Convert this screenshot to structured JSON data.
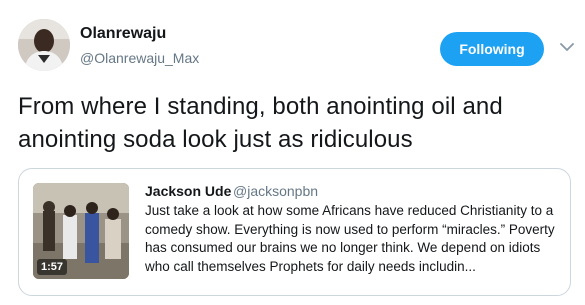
{
  "author": {
    "name": "Olanrewaju",
    "handle": "@Olanrewaju_Max"
  },
  "follow_button": {
    "label": "Following"
  },
  "tweet": {
    "text": "From where I standing, both anointing oil and anointing soda look just as ridiculous"
  },
  "quoted": {
    "name": "Jackson Ude",
    "handle": "@jacksonpbn",
    "text": "Just take a look at how some Africans have reduced Christianity to a comedy show. Everything is now used to perform “miracles.” Poverty has consumed our brains we no longer think. We depend on idiots who call themselves Prophets for daily needs includin...",
    "video_duration": "1:57"
  },
  "colors": {
    "accent": "#1da1f2",
    "muted_text": "#657786",
    "border": "#ccd6dd"
  },
  "icons": {
    "menu": "chevron-down-icon"
  }
}
